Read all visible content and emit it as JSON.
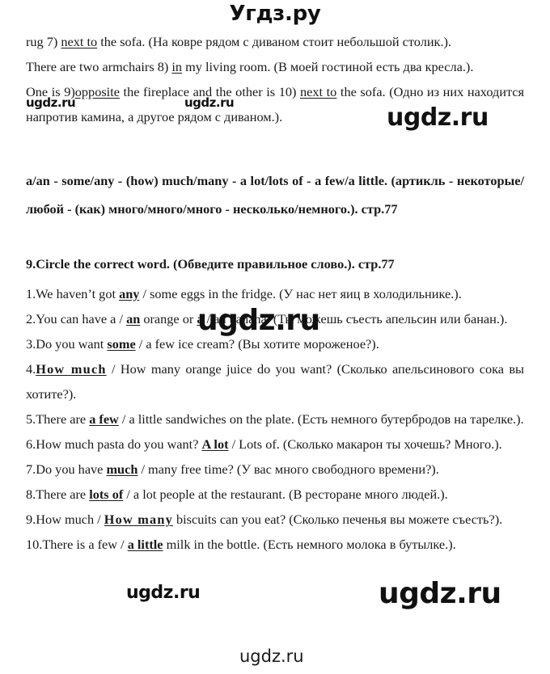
{
  "header": {
    "logo": "Угдз.ру"
  },
  "content": {
    "paragraphs": [
      {
        "id": "p-rug",
        "segments": [
          {
            "text": "rug 7) ",
            "style": "plain"
          },
          {
            "text": "next to",
            "style": "underline"
          },
          {
            "text": " the sofa. (На ковре рядом с диваном стоит небольшой столик.).",
            "style": "plain"
          }
        ]
      },
      {
        "id": "p-armchairs",
        "segments": [
          {
            "text": "There are two armchairs 8) ",
            "style": "plain"
          },
          {
            "text": "in",
            "style": "underline"
          },
          {
            "text": " my living room. (В моей гостиной есть два кресла.).",
            "style": "plain"
          }
        ]
      },
      {
        "id": "p-one-is",
        "segments": [
          {
            "text": "One is 9)",
            "style": "plain"
          },
          {
            "text": "opposite",
            "style": "underline"
          },
          {
            "text": " the fireplace and the other is 10) ",
            "style": "plain"
          },
          {
            "text": "next to",
            "style": "underline"
          },
          {
            "text": " the sofa. (Одно из них находится напротив камина, а другое рядом с диваном.).",
            "style": "plain"
          }
        ]
      }
    ],
    "grammar_note": "a/an - some/any - (how) much/many - a lot/lots of - a few/a little. (артикль - некоторые/любой - (как) много/много/много - несколько/немного.). стр.77",
    "exercise_title": "9.Circle the correct word. (Обведите правильное слово.). стр.77",
    "items": [
      {
        "number": "1.",
        "segments": [
          {
            "text": "We haven’t got ",
            "style": "plain"
          },
          {
            "text": "any",
            "style": "answer"
          },
          {
            "text": " / some eggs in the fridge. (У нас нет яиц в холодильнике.).",
            "style": "plain"
          }
        ]
      },
      {
        "number": "2.",
        "segments": [
          {
            "text": "You can have a / ",
            "style": "plain"
          },
          {
            "text": "an",
            "style": "answer"
          },
          {
            "text": " orange or ",
            "style": "plain"
          },
          {
            "text": "a",
            "style": "answer"
          },
          {
            "text": " / an banana. (Ты можешь съесть апельсин или банан.).",
            "style": "plain"
          }
        ]
      },
      {
        "number": "3.",
        "segments": [
          {
            "text": "Do you want ",
            "style": "plain"
          },
          {
            "text": "some",
            "style": "answer"
          },
          {
            "text": " / a few ice cream? (Вы хотите мороженое?).",
            "style": "plain"
          }
        ]
      },
      {
        "number": "4.",
        "segments": [
          {
            "text": "How much",
            "style": "answer-spaced"
          },
          {
            "text": " / How many orange juice do you want? (Сколько апельсинового сока вы хотите?).",
            "style": "plain"
          }
        ]
      },
      {
        "number": "5.",
        "segments": [
          {
            "text": "There are ",
            "style": "plain"
          },
          {
            "text": "a few",
            "style": "answer"
          },
          {
            "text": " / a little sandwiches on the plate. (Есть немного бутербродов на тарелке.).",
            "style": "plain"
          }
        ]
      },
      {
        "number": "6.",
        "segments": [
          {
            "text": "How much pasta do you want? ",
            "style": "plain"
          },
          {
            "text": "A lot",
            "style": "answer"
          },
          {
            "text": " / Lots of. (Сколько макарон ты хочешь? Много.).",
            "style": "plain"
          }
        ]
      },
      {
        "number": "7.",
        "segments": [
          {
            "text": "Do you have ",
            "style": "plain"
          },
          {
            "text": "much",
            "style": "answer"
          },
          {
            "text": " / many free time? (У вас много свободного времени?).",
            "style": "plain"
          }
        ]
      },
      {
        "number": "8.",
        "segments": [
          {
            "text": "There are ",
            "style": "plain"
          },
          {
            "text": "lots of",
            "style": "answer"
          },
          {
            "text": " / a lot people at the restaurant. (В ресторане много людей.).",
            "style": "plain"
          }
        ]
      },
      {
        "number": "9.",
        "segments": [
          {
            "text": "How much / ",
            "style": "plain"
          },
          {
            "text": "How many",
            "style": "answer-spaced"
          },
          {
            "text": " biscuits can you eat? (Сколько печенья вы можете съесть?).",
            "style": "plain"
          }
        ]
      },
      {
        "number": "10.",
        "segments": [
          {
            "text": "There is a few / ",
            "style": "plain"
          },
          {
            "text": "a little",
            "style": "answer"
          },
          {
            "text": " milk in the bottle. (Есть немного молока в бутылке.).",
            "style": "plain"
          }
        ]
      }
    ]
  },
  "watermarks": [
    {
      "id": "wm1",
      "text": "ugdz.ru",
      "size": "sm"
    },
    {
      "id": "wm2",
      "text": "ugdz.ru",
      "size": "sm"
    },
    {
      "id": "wm3",
      "text": "ugdz.ru",
      "size": "lg"
    },
    {
      "id": "wm4",
      "text": "ugdz.ru",
      "size": "xl"
    },
    {
      "id": "wm5",
      "text": "ugdz.ru",
      "size": "md"
    },
    {
      "id": "wm6",
      "text": "ugdz.ru",
      "size": "xl"
    },
    {
      "id": "wm7",
      "text": "ugdz.ru",
      "size": "foot"
    }
  ]
}
